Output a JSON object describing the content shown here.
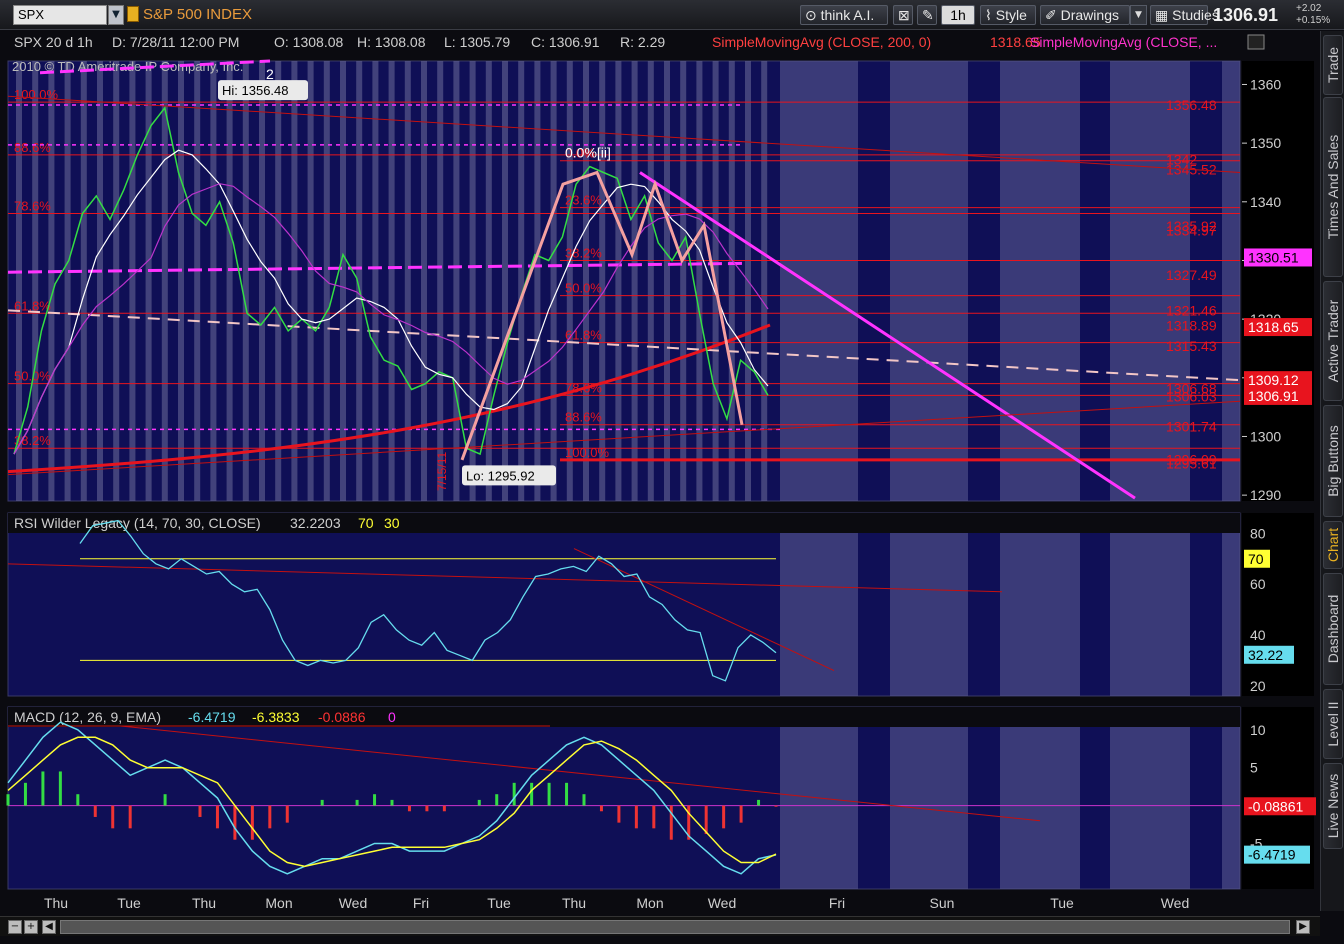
{
  "toolbar": {
    "symbol": "SPX",
    "instrument": "S&P 500 INDEX",
    "think": "think A.I.",
    "timeframe": "1h",
    "style": "Style",
    "drawings": "Drawings",
    "studies": "Studies",
    "last_price": "1306.91",
    "change": "+2.02",
    "change_pct": "+0.15%"
  },
  "tabs": [
    "Trade",
    "Times And Sales",
    "Active Trader",
    "Big Buttons",
    "Chart",
    "Dashboard",
    "Level II",
    "Live News"
  ],
  "chart_data": [
    {
      "type": "line",
      "panel": "price",
      "header": {
        "symbol": "SPX 20 d 1h",
        "date": "D: 7/28/11 12:00 PM",
        "open": "O: 1308.08",
        "high": "H: 1308.08",
        "low": "L: 1305.79",
        "close": "C: 1306.91",
        "range": "R: 2.29",
        "sma1": "SimpleMovingAvg (CLOSE, 200, 0)",
        "sma1_value": "1318.65",
        "sma2": "SimpleMovingAvg (CLOSE, ..."
      },
      "copyright": "2010 © TD Ameritrade IP Company, Inc.",
      "x_labels": [
        "Thu",
        "Tue",
        "Thu",
        "Mon",
        "Wed",
        "Fri",
        "Tue",
        "Thu",
        "Mon",
        "Wed",
        "Fri",
        "Sun",
        "Tue",
        "Wed"
      ],
      "y_ticks": [
        1290,
        1300,
        1310,
        1320,
        1330,
        1340,
        1350,
        1360
      ],
      "ylim": [
        1289,
        1364
      ],
      "hi_label": "Hi: 1356.48",
      "lo_label": "Lo: 1295.92",
      "close": [
        1297,
        1305,
        1318,
        1326,
        1330,
        1338,
        1341,
        1337,
        1342,
        1348,
        1353,
        1356,
        1345,
        1338,
        1336,
        1340,
        1333,
        1321,
        1319,
        1322,
        1318,
        1320,
        1318,
        1322,
        1331,
        1327,
        1317,
        1313,
        1312,
        1308,
        1309,
        1311,
        1310,
        1298,
        1297,
        1307,
        1316,
        1324,
        1331,
        1330,
        1334,
        1343,
        1346,
        1345,
        1344,
        1337,
        1341,
        1333,
        1330,
        1334,
        1321,
        1309,
        1303,
        1313,
        1311,
        1307
      ],
      "fib_left": [
        {
          "label": "100.0%",
          "value": 1357
        },
        {
          "label": "88.6%",
          "value": 1348
        },
        {
          "label": "78.6%",
          "value": 1338
        },
        {
          "label": "61.8%",
          "value": 1321
        },
        {
          "label": "50.0%",
          "value": 1309
        },
        {
          "label": "38.2%",
          "value": 1298
        }
      ],
      "fib_mid": [
        {
          "label": "0.0%",
          "value": 1347
        },
        {
          "label": "23.6%",
          "value": 1339
        },
        {
          "label": "38.2%",
          "value": 1330
        },
        {
          "label": "50.0%",
          "value": 1324
        },
        {
          "label": "61.8%",
          "value": 1316
        },
        {
          "label": "78.6%",
          "value": 1307
        },
        {
          "label": "88.6%",
          "value": 1302
        },
        {
          "label": "100.0%",
          "value": 1296
        }
      ],
      "fib_price_labels": [
        "1356.48",
        "1345.52",
        "1342",
        "1335.92",
        "1334.97",
        "1327.49",
        "1321.46",
        "1318.89",
        "1315.43",
        "1306.68",
        "1306.03",
        "1301.74",
        "1296.09",
        "1295.61"
      ],
      "annotations": [
        "2",
        "0.0%[ii]",
        "7/15/11"
      ],
      "badges": [
        {
          "text": "1330.51",
          "value": 1330.51,
          "bg": "#ff33ff",
          "fg": "#000000"
        },
        {
          "text": "1318.65",
          "value": 1318.65,
          "bg": "#e8141e",
          "fg": "#ffffff"
        },
        {
          "text": "1309.12",
          "value": 1309.6,
          "bg": "#e8141e",
          "fg": "#ffffff"
        },
        {
          "text": "1306.91",
          "value": 1306.91,
          "bg": "#e8141e",
          "fg": "#ffffff"
        }
      ]
    },
    {
      "type": "line",
      "panel": "rsi",
      "header": "RSI Wilder Legacy (14, 70, 30, CLOSE)",
      "value": "32.2203",
      "ob": "70",
      "os": "30",
      "y_ticks": [
        20,
        40,
        60,
        80
      ],
      "ylim": [
        16,
        88
      ],
      "badge_ob": "70",
      "badge_value": "32.22",
      "values": [
        76,
        83,
        84,
        85,
        79,
        72,
        68,
        66,
        70,
        67,
        64,
        65,
        60,
        57,
        58,
        50,
        38,
        30,
        28,
        30,
        29,
        30,
        35,
        45,
        48,
        42,
        38,
        36,
        41,
        34,
        32,
        30,
        38,
        41,
        46,
        55,
        63,
        64,
        66,
        67,
        65,
        71,
        68,
        63,
        64,
        55,
        52,
        46,
        42,
        41,
        24,
        22,
        35,
        40,
        37,
        33
      ]
    },
    {
      "type": "line",
      "panel": "macd",
      "header": "MACD (12, 26, 9, EMA)",
      "value": "-6.4719",
      "avg": "-6.3833",
      "diff": "-0.0886",
      "zero": "0",
      "y_ticks": [
        "10",
        "5",
        "-5"
      ],
      "ylim": [
        -11,
        13
      ],
      "badge_diff": "-0.08861",
      "badge_value": "-6.4719",
      "macd": [
        3,
        6,
        9,
        11,
        10,
        8,
        6,
        4,
        5,
        6,
        5,
        3,
        1,
        -3,
        -6,
        -8,
        -9,
        -8,
        -7,
        -7,
        -6,
        -5,
        -5,
        -6,
        -6,
        -6,
        -5,
        -4,
        -2,
        1,
        4,
        6,
        8,
        9,
        8,
        6,
        4,
        2,
        -1,
        -4,
        -6,
        -8,
        -9,
        -7,
        -6.5
      ],
      "signal": [
        2,
        4,
        6,
        8,
        9,
        9,
        8,
        6,
        5,
        5,
        5,
        4,
        3,
        0,
        -3,
        -6,
        -7.5,
        -8,
        -7.5,
        -7,
        -6.5,
        -6,
        -5.5,
        -5.5,
        -5.5,
        -5.5,
        -5,
        -4.5,
        -3,
        -1,
        2,
        4,
        6,
        8,
        8.5,
        7.5,
        6,
        4,
        2,
        -1,
        -3.5,
        -6,
        -7.5,
        -7.5,
        -6.4
      ]
    }
  ],
  "colors": {
    "bg": "#0f0f56",
    "stripe": "#5e5f96",
    "grid": "#8a8ab0",
    "fib": "#e8141e",
    "pink": "#ff33ff",
    "white": "#ffffff",
    "rsi": "#66ddee",
    "yellow": "#ffff33",
    "axis": "#cfcfcf"
  }
}
